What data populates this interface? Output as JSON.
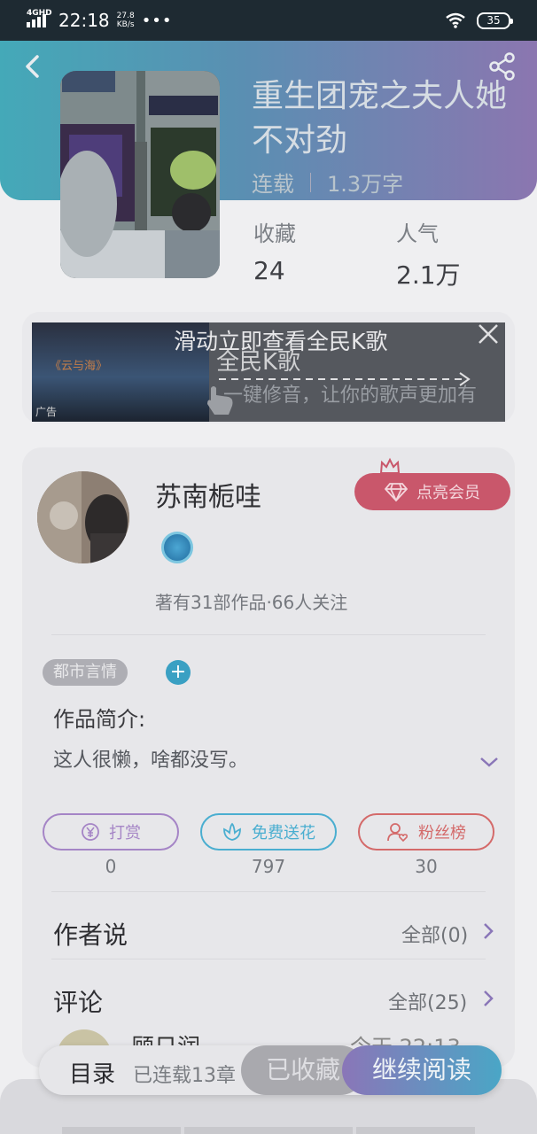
{
  "status_bar": {
    "network": "4GHD",
    "time": "22:18",
    "speed_value": "27.8",
    "speed_unit": "KB/s",
    "dots": "•••",
    "battery": "35"
  },
  "book": {
    "title": "重生团宠之夫人她不对劲",
    "status": "连载",
    "word_count": "1.3万字",
    "favorites_label": "收藏",
    "favorites_value": "24",
    "popularity_label": "人气",
    "popularity_value": "2.1万"
  },
  "ad": {
    "hint": "滑动立即查看全民K歌",
    "image_title": "《云与海》",
    "brand": "全民K歌",
    "description": "一键修音，让你的歌声更加有",
    "tag": "广告"
  },
  "author": {
    "name": "苏南栀哇",
    "stats": "著有31部作品·66人关注",
    "vip_label": "点亮会员",
    "genre": "都市言情",
    "add_tag": "+",
    "intro_title": "作品简介:",
    "intro_text": "这人很懒，啥都没写。"
  },
  "actions": [
    {
      "label": "打赏",
      "count": "0",
      "color": "#a585c6",
      "icon": "yuan-icon"
    },
    {
      "label": "免费送花",
      "count": "797",
      "color": "#4aaed0",
      "icon": "flower-icon"
    },
    {
      "label": "粉丝榜",
      "count": "30",
      "color": "#d46a6a",
      "icon": "fan-icon"
    }
  ],
  "author_says": {
    "title": "作者说",
    "link": "全部(0)"
  },
  "comments": {
    "title": "评论",
    "link": "全部(25)",
    "first_name": "顾日润",
    "first_time": "今天 22:13"
  },
  "bottom": {
    "toc": "目录",
    "serial": "已连载13章",
    "collected": "已收藏",
    "continue": "继续阅读"
  },
  "colors": {
    "accent_purple": "#8a76b8",
    "accent_teal": "#4aa6c6",
    "vip": "#c9576b"
  }
}
